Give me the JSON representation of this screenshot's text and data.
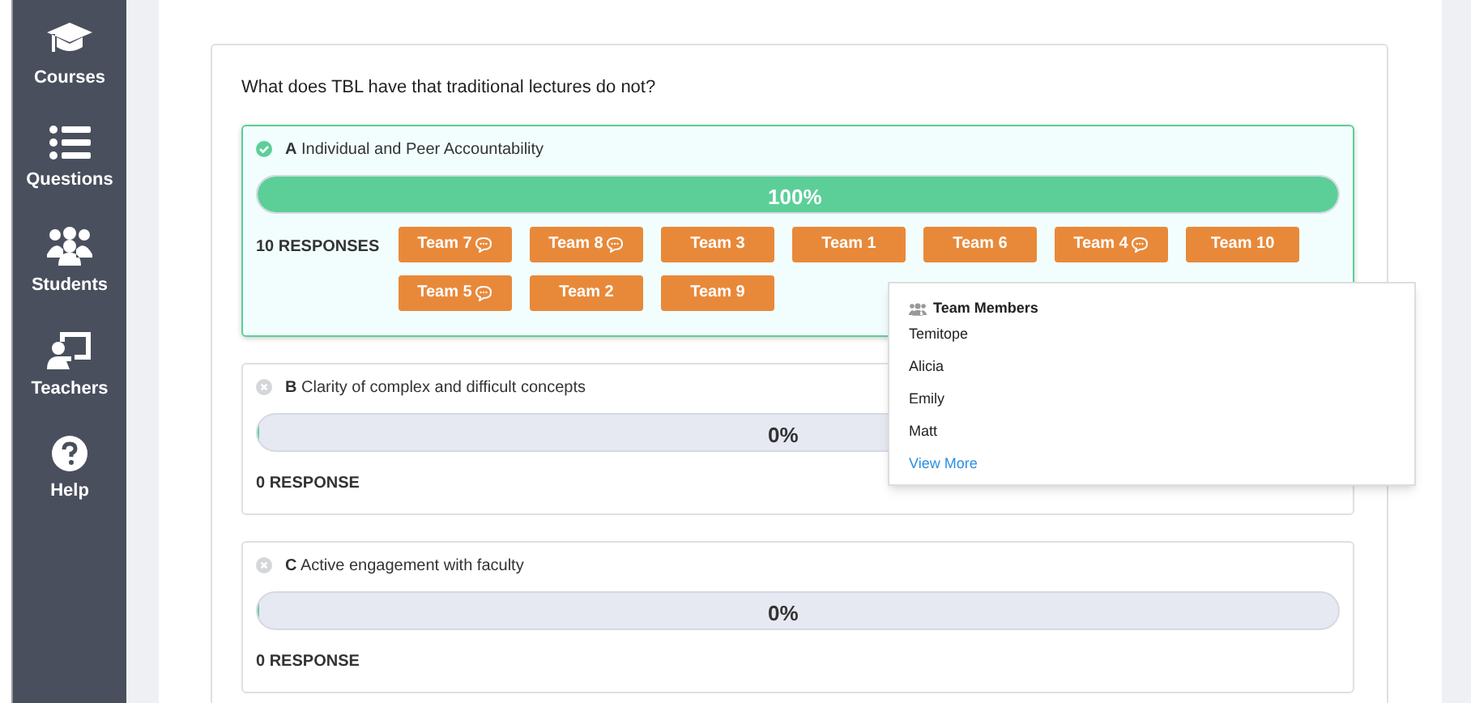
{
  "sidebar": {
    "items": [
      {
        "label": "Courses"
      },
      {
        "label": "Questions"
      },
      {
        "label": "Students"
      },
      {
        "label": "Teachers"
      },
      {
        "label": "Help"
      }
    ]
  },
  "question": "What does TBL have that traditional lectures do not?",
  "options": [
    {
      "letter": "A",
      "text": "Individual and Peer Accountability",
      "correct": true,
      "level": 1,
      "percent": "100%",
      "responses": "10 RESPONSES",
      "teams": [
        {
          "label": "Team 7",
          "comment": true
        },
        {
          "label": "Team 8",
          "comment": true
        },
        {
          "label": "Team 3",
          "comment": false
        },
        {
          "label": "Team 1",
          "comment": false
        },
        {
          "label": "Team 6",
          "comment": false
        },
        {
          "label": "Team 4",
          "comment": true
        },
        {
          "label": "Team 10",
          "comment": false
        },
        {
          "label": "Team 5",
          "comment": true
        },
        {
          "label": "Team 2",
          "comment": false
        },
        {
          "label": "Team 9",
          "comment": false
        }
      ]
    },
    {
      "letter": "B",
      "text": "Clarity of complex and difficult concepts",
      "correct": false,
      "level": 0,
      "percent": "0%",
      "responses": "0 RESPONSE"
    },
    {
      "letter": "C",
      "text": "Active engagement with faculty",
      "correct": false,
      "level": 0,
      "percent": "0%",
      "responses": "0 RESPONSE"
    }
  ],
  "popover": {
    "title": "Team Members",
    "members": [
      "Temitope",
      "Alicia",
      "Emily",
      "Matt"
    ],
    "link": "View More"
  }
}
